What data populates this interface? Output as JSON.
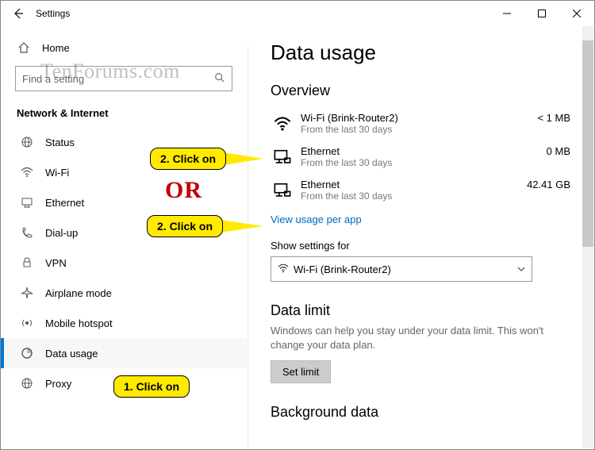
{
  "window": {
    "title": "Settings"
  },
  "watermark": "TenForums.com",
  "sidebar": {
    "home": "Home",
    "search_placeholder": "Find a setting",
    "section": "Network & Internet",
    "items": [
      {
        "label": "Status"
      },
      {
        "label": "Wi-Fi"
      },
      {
        "label": "Ethernet"
      },
      {
        "label": "Dial-up"
      },
      {
        "label": "VPN"
      },
      {
        "label": "Airplane mode"
      },
      {
        "label": "Mobile hotspot"
      },
      {
        "label": "Data usage"
      },
      {
        "label": "Proxy"
      }
    ]
  },
  "content": {
    "page_title": "Data usage",
    "overview_label": "Overview",
    "usage": [
      {
        "name": "Wi-Fi (Brink-Router2)",
        "sub": "From the last 30 days",
        "amount": "< 1 MB"
      },
      {
        "name": "Ethernet",
        "sub": "From the last 30 days",
        "amount": "0 MB"
      },
      {
        "name": "Ethernet",
        "sub": "From the last 30 days",
        "amount": "42.41 GB"
      }
    ],
    "view_usage_link": "View usage per app",
    "show_settings_label": "Show settings for",
    "selected_network": "Wi-Fi (Brink-Router2)",
    "data_limit_heading": "Data limit",
    "data_limit_desc": "Windows can help you stay under your data limit. This won't change your data plan.",
    "set_limit_btn": "Set limit",
    "background_heading": "Background data"
  },
  "callouts": {
    "c1": "2. Click on",
    "c2": "2. Click on",
    "c3": "1. Click on",
    "or": "OR"
  }
}
